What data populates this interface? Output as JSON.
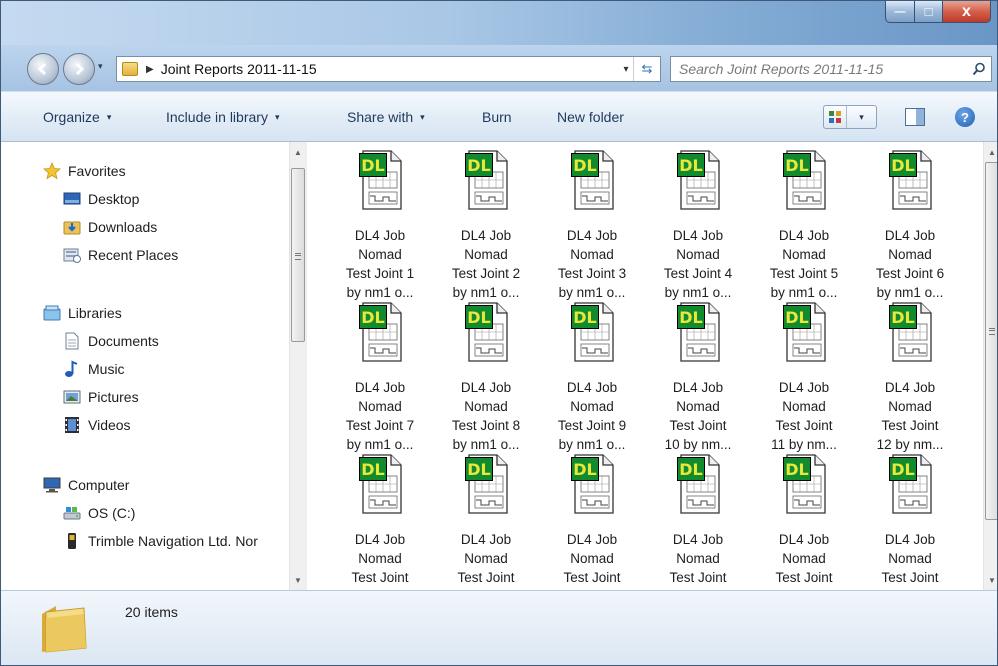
{
  "titlebar": {
    "minimize_symbol": "—",
    "maximize_symbol": "□",
    "close_symbol": "x"
  },
  "address": {
    "path": "Joint Reports 2011-11-15",
    "dropdown_symbol": "▾",
    "separator_symbol": "▶",
    "refresh_symbol": "⇆"
  },
  "search": {
    "placeholder": "Search Joint Reports 2011-11-15"
  },
  "toolbar": {
    "organize": "Organize",
    "include_in_library": "Include in library",
    "share_with": "Share with",
    "burn": "Burn",
    "new_folder": "New folder",
    "help_symbol": "?"
  },
  "nav": {
    "favorites": {
      "label": "Favorites",
      "items": [
        "Desktop",
        "Downloads",
        "Recent Places"
      ]
    },
    "libraries": {
      "label": "Libraries",
      "items": [
        "Documents",
        "Music",
        "Pictures",
        "Videos"
      ]
    },
    "computer": {
      "label": "Computer",
      "items": [
        "OS (C:)",
        "Trimble Navigation Ltd. Nor"
      ]
    }
  },
  "file_icon": {
    "badge": "DL",
    "badge_color": "#e8e83a",
    "badge_bg": "#128a2e"
  },
  "files": [
    {
      "l1": "DL4 Job",
      "l2": "Nomad",
      "l3": "Test Joint 1",
      "l4": "by nm1 o..."
    },
    {
      "l1": "DL4 Job",
      "l2": "Nomad",
      "l3": "Test Joint 2",
      "l4": "by nm1 o..."
    },
    {
      "l1": "DL4 Job",
      "l2": "Nomad",
      "l3": "Test Joint 3",
      "l4": "by nm1 o..."
    },
    {
      "l1": "DL4 Job",
      "l2": "Nomad",
      "l3": "Test Joint 4",
      "l4": "by nm1 o..."
    },
    {
      "l1": "DL4 Job",
      "l2": "Nomad",
      "l3": "Test Joint 5",
      "l4": "by nm1 o..."
    },
    {
      "l1": "DL4 Job",
      "l2": "Nomad",
      "l3": "Test Joint 6",
      "l4": "by nm1 o..."
    },
    {
      "l1": "DL4 Job",
      "l2": "Nomad",
      "l3": "Test Joint 7",
      "l4": "by nm1 o..."
    },
    {
      "l1": "DL4 Job",
      "l2": "Nomad",
      "l3": "Test Joint 8",
      "l4": "by nm1 o..."
    },
    {
      "l1": "DL4 Job",
      "l2": "Nomad",
      "l3": "Test Joint 9",
      "l4": "by nm1 o..."
    },
    {
      "l1": "DL4 Job",
      "l2": "Nomad",
      "l3": "Test Joint",
      "l4": "10 by nm..."
    },
    {
      "l1": "DL4 Job",
      "l2": "Nomad",
      "l3": "Test Joint",
      "l4": "11 by nm..."
    },
    {
      "l1": "DL4 Job",
      "l2": "Nomad",
      "l3": "Test Joint",
      "l4": "12 by nm..."
    },
    {
      "l1": "DL4 Job",
      "l2": "Nomad",
      "l3": "Test Joint",
      "l4": ""
    },
    {
      "l1": "DL4 Job",
      "l2": "Nomad",
      "l3": "Test Joint",
      "l4": ""
    },
    {
      "l1": "DL4 Job",
      "l2": "Nomad",
      "l3": "Test Joint",
      "l4": ""
    },
    {
      "l1": "DL4 Job",
      "l2": "Nomad",
      "l3": "Test Joint",
      "l4": ""
    },
    {
      "l1": "DL4 Job",
      "l2": "Nomad",
      "l3": "Test Joint",
      "l4": ""
    },
    {
      "l1": "DL4 Job",
      "l2": "Nomad",
      "l3": "Test Joint",
      "l4": ""
    }
  ],
  "status": {
    "item_count": "20 items"
  }
}
